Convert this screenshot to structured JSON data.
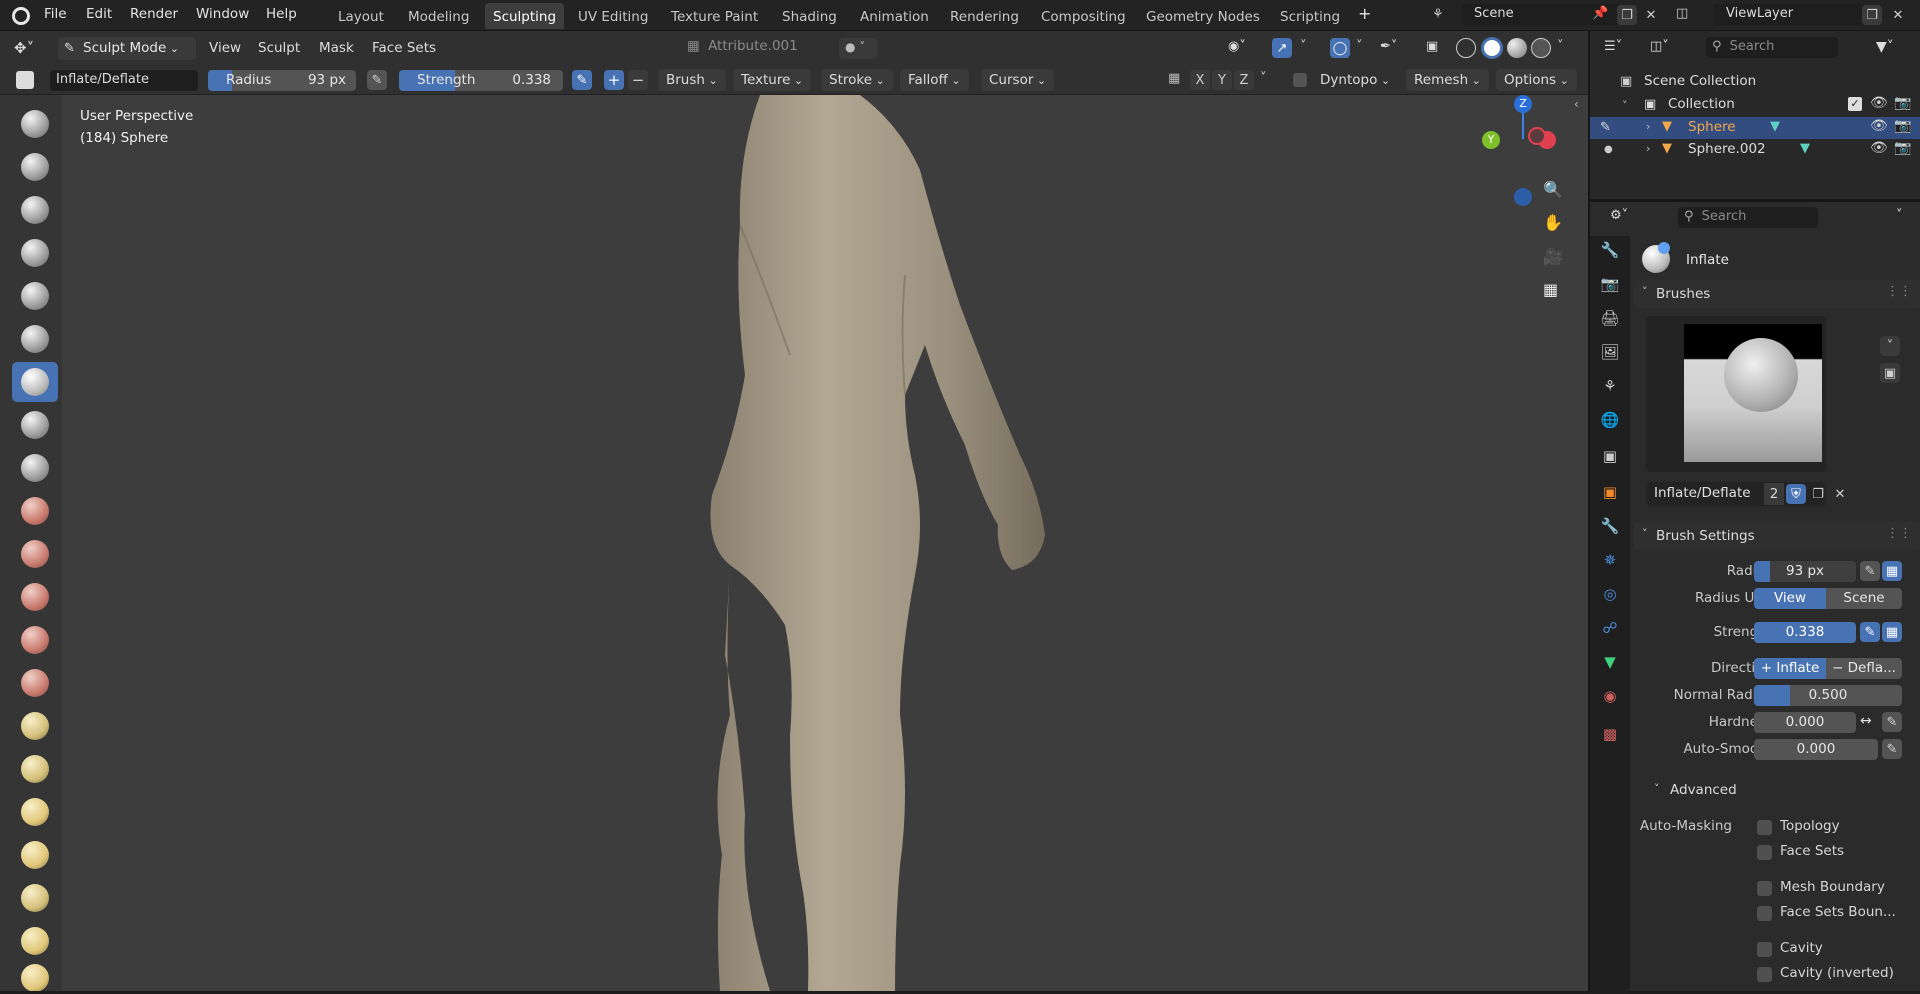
{
  "topbar": {
    "menus": [
      "File",
      "Edit",
      "Render",
      "Window",
      "Help"
    ],
    "workspaces": [
      "Layout",
      "Modeling",
      "Sculpting",
      "UV Editing",
      "Texture Paint",
      "Shading",
      "Animation",
      "Rendering",
      "Compositing",
      "Geometry Nodes",
      "Scripting"
    ],
    "active_workspace": "Sculpting",
    "add_tab": "+",
    "scene": "Scene",
    "view_layer": "ViewLayer"
  },
  "header": {
    "mode": "Sculpt Mode",
    "menus": [
      "View",
      "Sculpt",
      "Mask",
      "Face Sets"
    ],
    "attribute": "Attribute.001",
    "brush_name": "Inflate/Deflate",
    "radius_label": "Radius",
    "radius_value": "93 px",
    "strength_label": "Strength",
    "strength_value": "0.338",
    "plus": "+",
    "minus": "−",
    "dropdowns": [
      "Brush",
      "Texture",
      "Stroke",
      "Falloff",
      "Cursor"
    ],
    "axes": [
      "X",
      "Y",
      "Z"
    ],
    "dyntopo": "Dyntopo",
    "remesh": "Remesh",
    "options": "Options"
  },
  "viewport": {
    "perspective": "User Perspective",
    "object_info": "(184) Sphere",
    "gizmo": {
      "z": "Z",
      "y": "Y"
    }
  },
  "outliner": {
    "search_placeholder": "Search",
    "scene_collection": "Scene Collection",
    "collection": "Collection",
    "objects": [
      "Sphere",
      "Sphere.002"
    ],
    "selected_object": "Sphere"
  },
  "properties": {
    "search_placeholder": "Search",
    "brush_title": "Inflate",
    "brushes_section": "Brushes",
    "brush_datablock": "Inflate/Deflate",
    "brush_users": "2",
    "brush_settings_section": "Brush Settings",
    "rows": {
      "radius": {
        "label": "Radius",
        "value": "93 px"
      },
      "radius_unit": {
        "label": "Radius Unit",
        "options": [
          "View",
          "Scene"
        ],
        "selected": "View"
      },
      "strength": {
        "label": "Strength",
        "value": "0.338"
      },
      "direction": {
        "label": "Direction",
        "options": [
          "+ Inflate",
          "− Defla..."
        ],
        "selected": "+ Inflate"
      },
      "normal_radius": {
        "label": "Normal Radius",
        "value": "0.500"
      },
      "hardness": {
        "label": "Hardness",
        "value": "0.000"
      },
      "auto_smooth": {
        "label": "Auto-Smooth",
        "value": "0.000"
      }
    },
    "advanced_section": "Advanced",
    "auto_masking_label": "Auto-Masking",
    "auto_masking": [
      "Topology",
      "Face Sets",
      "Mesh Boundary",
      "Face Sets Boun...",
      "Cavity",
      "Cavity (inverted)"
    ]
  },
  "colors": {
    "accent": "#4772b3",
    "panel": "#2b2b2b",
    "viewport": "#3d3d3d",
    "selected_text": "#f0a94a"
  }
}
